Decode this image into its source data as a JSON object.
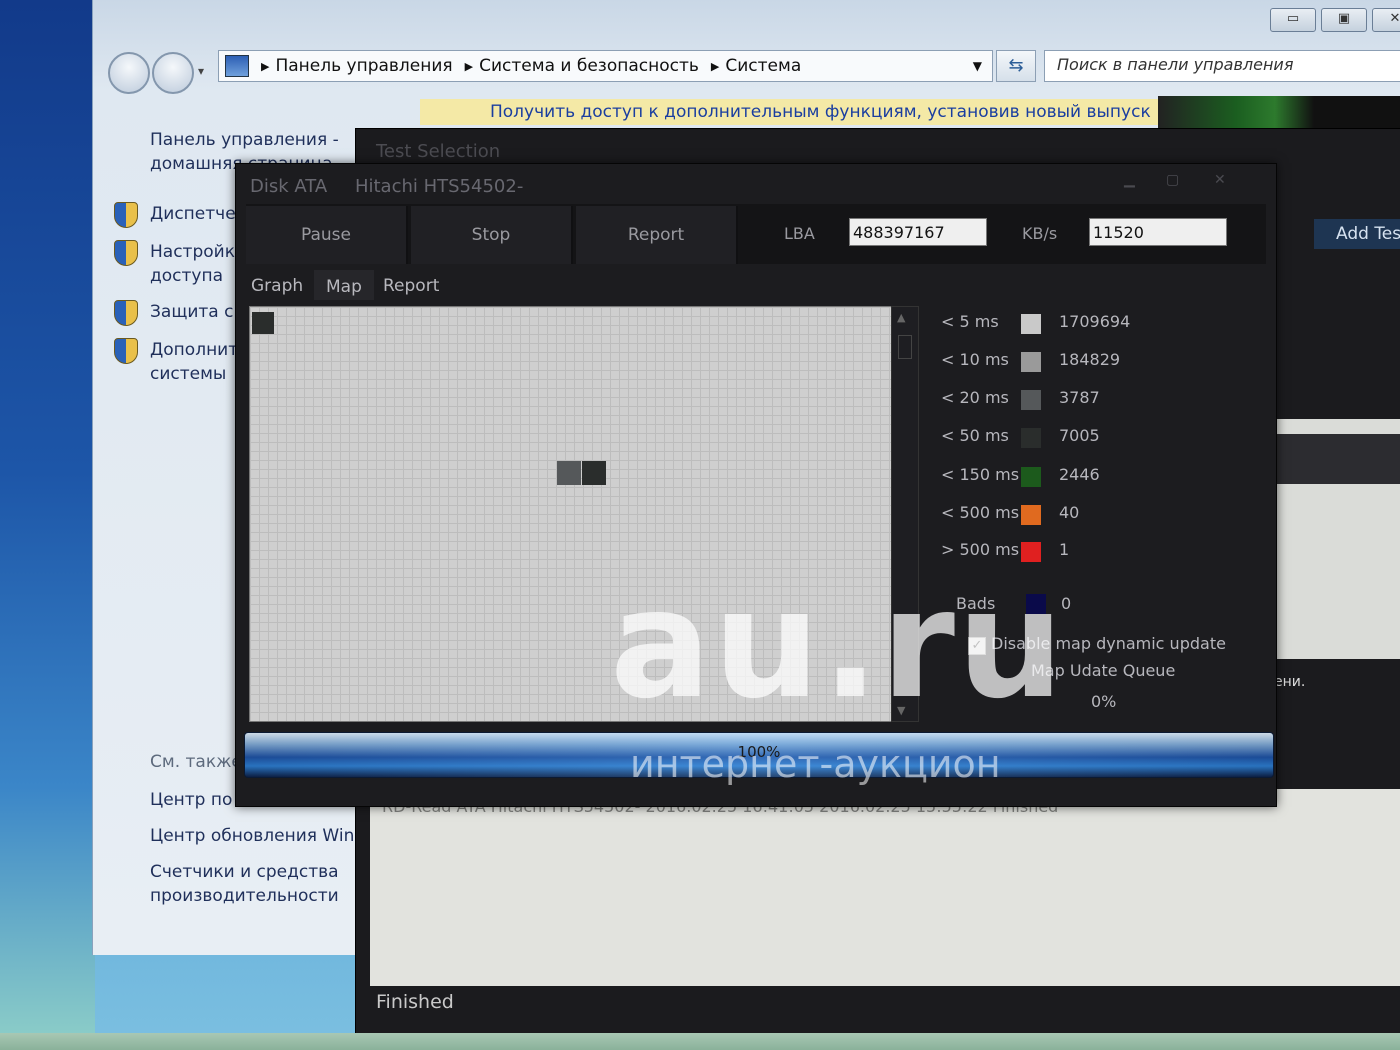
{
  "explorer": {
    "window_controls": [
      "▭",
      "▣",
      "✕"
    ],
    "breadcrumb": [
      "Панель управления",
      "Система и безопасность",
      "Система"
    ],
    "search_placeholder": "Поиск в панели управления",
    "infobar_text": "Получить доступ к дополнительным функциям, установив новый выпуск",
    "left_pane": {
      "home_link": [
        "Панель управления -",
        "домашняя страница"
      ],
      "items": [
        [
          "Диспетче"
        ],
        [
          "Настройк",
          "доступа"
        ],
        [
          "Защита с"
        ],
        [
          "Дополнит",
          "системы"
        ]
      ],
      "see_also": "См. также",
      "links": [
        [
          "Центр по"
        ],
        [
          "Центр обновления Win"
        ],
        [
          "Счетчики и средства",
          "производительности"
        ]
      ]
    }
  },
  "back_window": {
    "title": "Test Selection",
    "add_test": "Add Test",
    "row_text": "RD-Read        ATA    Hitachi HTS54502-        2016.02.25 16:41:05        2016.02.25 15:55:22        Finished",
    "side_text": "ени.",
    "status": "Finished"
  },
  "disk_window": {
    "title_parts": [
      "Disk ATA",
      "Hitachi HTS54502-"
    ],
    "toolbar": {
      "pause": "Pause",
      "stop": "Stop",
      "report": "Report",
      "lba_label": "LBA",
      "lba_value": "488397167",
      "kbs_label": "KB/s",
      "kbs_value": "11520"
    },
    "tabs": [
      "Graph",
      "Map",
      "Report"
    ],
    "active_tab": "Map",
    "legend": [
      {
        "label": "< 5 ms",
        "value": "1709694",
        "color": "#c9c9c9"
      },
      {
        "label": "< 10 ms",
        "value": "184829",
        "color": "#9a9a9a"
      },
      {
        "label": "< 20 ms",
        "value": "3787",
        "color": "#55585a"
      },
      {
        "label": "< 50 ms",
        "value": "7005",
        "color": "#2a2d2c"
      },
      {
        "label": "< 150 ms",
        "value": "2446",
        "color": "#1c5a1c"
      },
      {
        "label": "< 500 ms",
        "value": "40",
        "color": "#e06a1f"
      },
      {
        "label": "> 500 ms",
        "value": "1",
        "color": "#e02020"
      }
    ],
    "bads_label": "Bads",
    "bads_value": "0",
    "disable_map_update": "Disable map dynamic update",
    "map_queue_label": "Map Udate Queue",
    "map_queue_pct": "0%",
    "progress": {
      "percent_text": "100%",
      "fraction": 1.0
    }
  },
  "watermark": {
    "logo": "au.ru",
    "subtitle": "интернет-аукцион"
  }
}
